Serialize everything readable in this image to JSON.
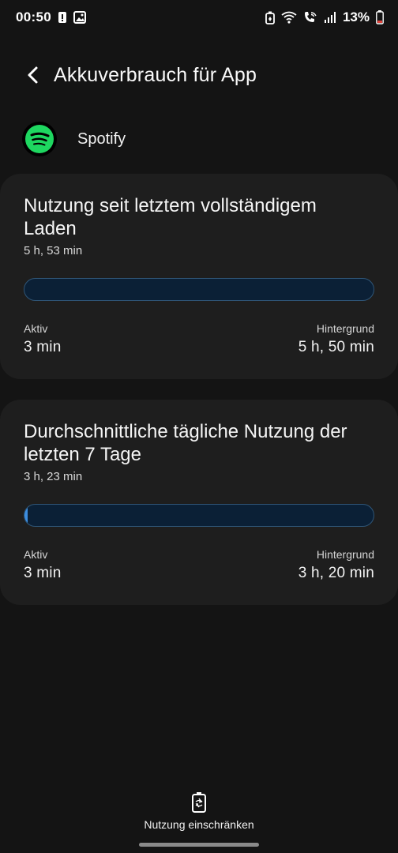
{
  "status_bar": {
    "time": "00:50",
    "battery_percent": "13%",
    "icons": [
      "alert-icon",
      "image-icon",
      "battery-saver-icon",
      "wifi-icon",
      "wifi-calling-icon",
      "signal-icon",
      "battery-icon"
    ]
  },
  "header": {
    "title": "Akkuverbrauch für App",
    "back_icon": "back-arrow-icon"
  },
  "app": {
    "name": "Spotify",
    "icon": "spotify-icon",
    "brand_color": "#1ED760"
  },
  "cards": [
    {
      "title": "Nutzung seit letztem vollständigem Laden",
      "total": "5 h, 53 min",
      "active_fraction": 0.0,
      "active_label": "Aktiv",
      "active_value": "3 min",
      "background_label": "Hintergrund",
      "background_value": "5 h, 50 min"
    },
    {
      "title": "Durchschnittliche tägliche Nutzung der letzten 7 Tage",
      "total": "3 h, 23 min",
      "active_fraction": 0.01,
      "active_label": "Aktiv",
      "active_value": "3 min",
      "background_label": "Hintergrund",
      "background_value": "3 h, 20 min"
    }
  ],
  "bottom_action": {
    "label": "Nutzung einschränken",
    "icon": "battery-restrict-icon"
  },
  "colors": {
    "background": "#141414",
    "card": "#1e1e1e",
    "bar_track": "#0b2036",
    "bar_fill": "#3d8ee0"
  }
}
